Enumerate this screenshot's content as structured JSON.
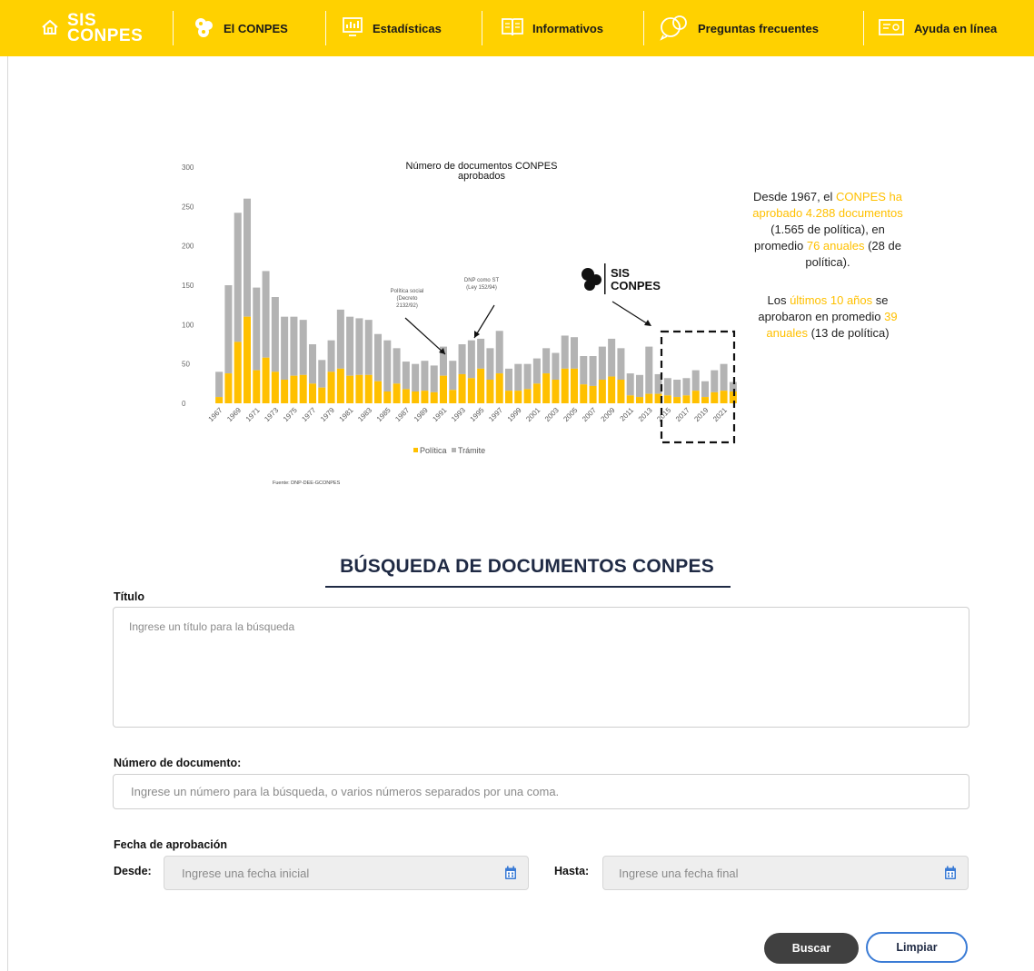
{
  "nav": {
    "logo": "SIS CONPES",
    "items": [
      {
        "label": "El CONPES",
        "icon": "gear-cluster-icon"
      },
      {
        "label": "Estadísticas",
        "icon": "stats-monitor-icon"
      },
      {
        "label": "Informativos",
        "icon": "book-icon"
      },
      {
        "label": "Preguntas frecuentes",
        "icon": "chat-bubbles-icon"
      },
      {
        "label": "Ayuda en línea",
        "icon": "help-screen-icon"
      }
    ]
  },
  "colors": {
    "brand_yellow": "#ffd100",
    "politica": "#ffc000",
    "tramite": "#b3b3b3",
    "dark": "#404040"
  },
  "chart_data": {
    "type": "bar",
    "stacked": true,
    "title": "Número de documentos CONPES aprobados",
    "ylim": [
      0,
      300
    ],
    "yticks": [
      0,
      50,
      100,
      150,
      200,
      250,
      300
    ],
    "categories": [
      "1967",
      "1968",
      "1969",
      "1970",
      "1971",
      "1972",
      "1973",
      "1974",
      "1975",
      "1976",
      "1977",
      "1978",
      "1979",
      "1980",
      "1981",
      "1982",
      "1983",
      "1984",
      "1985",
      "1986",
      "1987",
      "1988",
      "1989",
      "1990",
      "1991",
      "1992",
      "1993",
      "1994",
      "1995",
      "1996",
      "1997",
      "1998",
      "1999",
      "2000",
      "2001",
      "2002",
      "2003",
      "2004",
      "2005",
      "2006",
      "2007",
      "2008",
      "2009",
      "2010",
      "2011",
      "2012",
      "2013",
      "2014",
      "2015",
      "2016",
      "2017",
      "2018",
      "2019",
      "2020",
      "2021",
      "2022"
    ],
    "xtick_labels": [
      "1967",
      "1969",
      "1971",
      "1973",
      "1975",
      "1977",
      "1979",
      "1981",
      "1983",
      "1985",
      "1987",
      "1989",
      "1991",
      "1993",
      "1995",
      "1997",
      "1999",
      "2001",
      "2003",
      "2005",
      "2007",
      "2009",
      "2011",
      "2013",
      "2015",
      "2017",
      "2019",
      "2021"
    ],
    "series": [
      {
        "name": "Política",
        "values": [
          8,
          38,
          78,
          110,
          42,
          58,
          40,
          30,
          35,
          36,
          25,
          20,
          40,
          44,
          35,
          36,
          36,
          28,
          15,
          25,
          18,
          15,
          16,
          14,
          35,
          17,
          37,
          32,
          44,
          30,
          38,
          16,
          16,
          18,
          25,
          38,
          30,
          44,
          44,
          24,
          22,
          30,
          34,
          30,
          10,
          8,
          12,
          12,
          10,
          8,
          10,
          16,
          8,
          14,
          16,
          15
        ]
      },
      {
        "name": "Trámite",
        "values": [
          32,
          112,
          164,
          150,
          105,
          110,
          95,
          80,
          75,
          70,
          50,
          35,
          40,
          75,
          75,
          72,
          70,
          60,
          65,
          45,
          35,
          35,
          38,
          34,
          37,
          37,
          38,
          48,
          38,
          40,
          54,
          28,
          34,
          32,
          32,
          32,
          34,
          42,
          40,
          36,
          38,
          42,
          48,
          40,
          28,
          28,
          60,
          25,
          22,
          22,
          22,
          26,
          20,
          28,
          34,
          12
        ]
      }
    ],
    "annotations": [
      {
        "text": [
          "Política social",
          "(Decreto",
          "2132/92)"
        ]
      },
      {
        "text": [
          "DNP como ST",
          "(Ley 152/94)"
        ]
      }
    ],
    "inset_logo": "SIS CONPES",
    "source": "Fuente: DNP-DEE-GCONPES",
    "legend_position": "bottom"
  },
  "stats": {
    "p1": {
      "a": "Desde 1967, el ",
      "b": "CONPES ha aprobado 4.288 documentos",
      "c": " (1.565 de política), en promedio ",
      "d": "76 anuales",
      "e": " (28 de política)."
    },
    "p2": {
      "a": "Los ",
      "b": "últimos 10 años",
      "c": " se aprobaron en promedio ",
      "d": "39 anuales",
      "e": " (13 de política)"
    }
  },
  "search": {
    "title": "BÚSQUEDA DE DOCUMENTOS CONPES",
    "titulo_label": "Título",
    "titulo_placeholder": "Ingrese un título para la búsqueda",
    "numero_label": "Número de documento:",
    "numero_placeholder": "Ingrese un número para la búsqueda, o varios números separados por una coma.",
    "fecha_label": "Fecha de aprobación",
    "desde_label": "Desde:",
    "desde_placeholder": "Ingrese una fecha inicial",
    "hasta_label": "Hasta:",
    "hasta_placeholder": "Ingrese una fecha final",
    "buscar": "Buscar",
    "limpiar": "Limpiar"
  }
}
